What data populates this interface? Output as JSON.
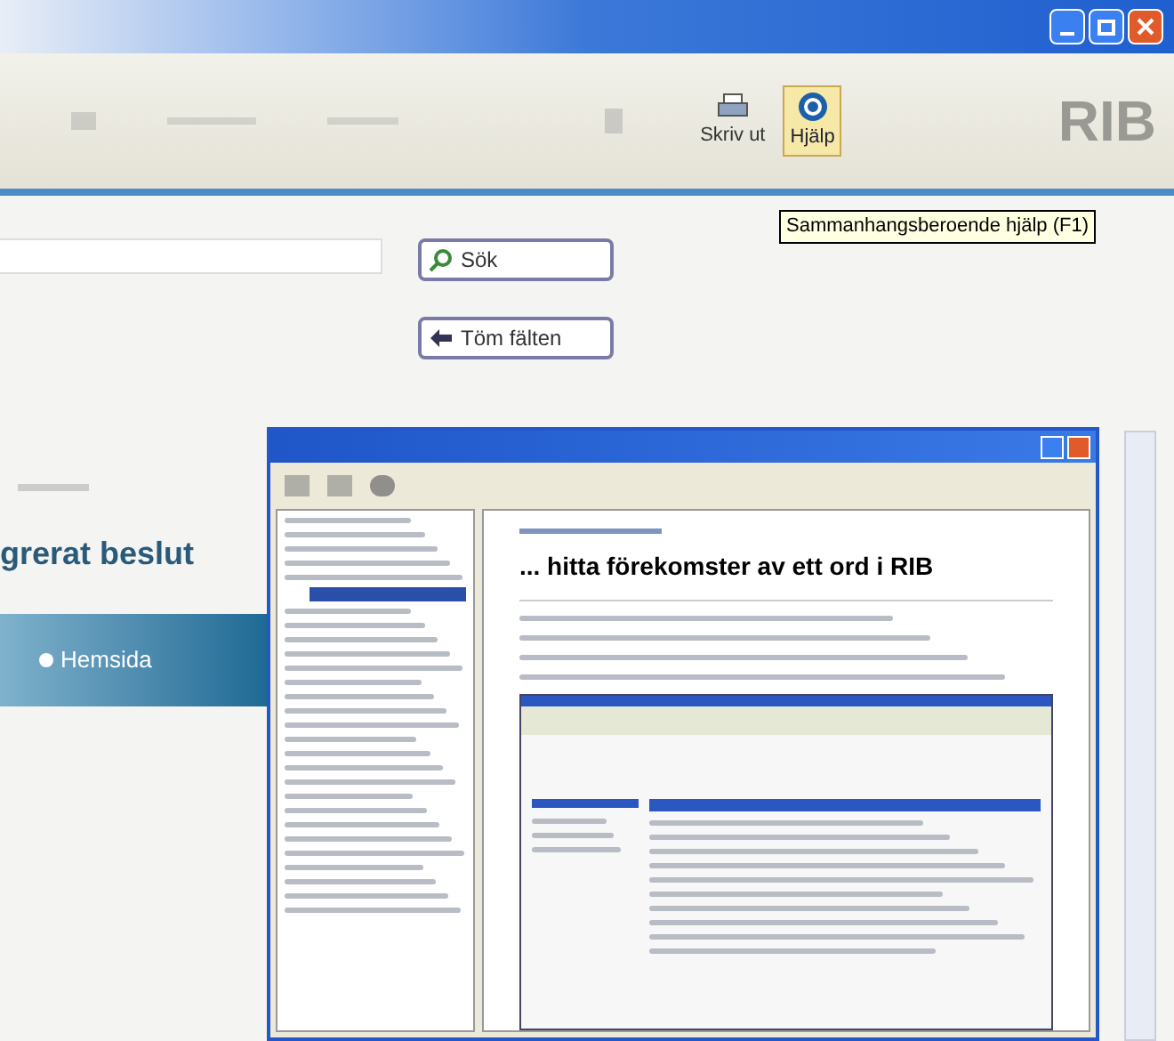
{
  "toolbar": {
    "buttons": [
      {
        "kind": "print",
        "label": "Skriv ut",
        "selected": false
      },
      {
        "kind": "help",
        "label": "Hjälp",
        "selected": true
      }
    ],
    "logo": "RIB",
    "tooltip": "Sammanhangsberoende hjälp (F1)"
  },
  "search": {
    "buttons": [
      {
        "kind": "search",
        "label": "Sök"
      },
      {
        "kind": "clear",
        "label": "Töm fälten"
      }
    ]
  },
  "page": {
    "heading": "grerat beslut",
    "nav": [
      "Hemsida"
    ]
  },
  "help_window": {
    "heading": "... hitta förekomster av ett ord i RIB"
  }
}
